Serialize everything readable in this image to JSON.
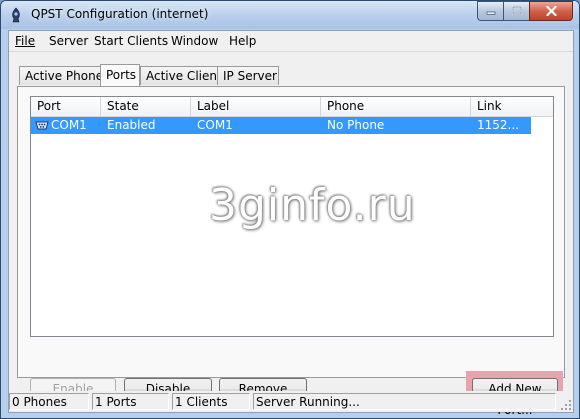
{
  "window": {
    "title": "QPST Configuration (internet)",
    "icons": {
      "app": "qpst-app-icon",
      "minimize": "minimize-icon",
      "maximize": "maximize-icon",
      "close": "close-icon"
    }
  },
  "menu": {
    "file": "File",
    "server": "Server",
    "start_clients": "Start Clients",
    "window": "Window",
    "help": "Help"
  },
  "tabs": {
    "active_phones": "Active Phones",
    "ports": "Ports",
    "active_clients": "Active Clients",
    "ip_server": "IP Server",
    "selected": "Ports"
  },
  "ports_list": {
    "columns": {
      "port": "Port",
      "state": "State",
      "label": "Label",
      "phone": "Phone",
      "link": "Link"
    },
    "rows": [
      {
        "port": "COM1",
        "state": "Enabled",
        "label": "COM1",
        "phone": "No Phone",
        "link": "1152...",
        "selected": true,
        "icon": "serial-port-icon"
      }
    ]
  },
  "watermark": "3ginfo.ru",
  "buttons": {
    "enable": "Enable",
    "disable": "Disable",
    "remove": "Remove",
    "add_new_port": "Add New Port..."
  },
  "status_bar": {
    "phones": "0 Phones",
    "ports": "1 Ports",
    "clients": "1 Clients",
    "server": "Server Running..."
  },
  "colors": {
    "selection": "#3399ff",
    "highlight": "#e8a3ad",
    "close_button": "#c1402a"
  }
}
